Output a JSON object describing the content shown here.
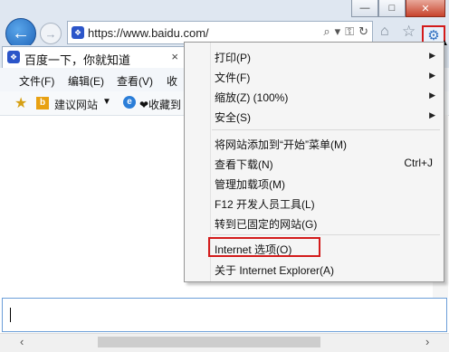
{
  "window": {
    "minimize": "—",
    "maximize": "□",
    "close": "✕"
  },
  "nav": {
    "back": "←",
    "forward": "→"
  },
  "address": {
    "url": "https://www.baidu.com/",
    "search": "⌕",
    "dropdown": "▾",
    "lock": "⚿",
    "refresh": "↻"
  },
  "toolbar": {
    "home": "⌂",
    "favorites": "☆",
    "tools": "⚙"
  },
  "tab": {
    "title": "百度一下，你就知道",
    "close": "×"
  },
  "menubar": [
    "文件(F)",
    "编辑(E)",
    "查看(V)",
    "收"
  ],
  "favbar": {
    "site": "建议网站",
    "arrow": "▼",
    "collect": "❤收藏到"
  },
  "scroll": {
    "left": "‹",
    "right": "›"
  },
  "tools_menu": {
    "print": "打印(P)",
    "file": "文件(F)",
    "zoom": "缩放(Z) (100%)",
    "safety": "安全(S)",
    "add_start": "将网站添加到“开始”菜单(M)",
    "downloads": "查看下载(N)",
    "downloads_shortcut": "Ctrl+J",
    "addons": "管理加载项(M)",
    "devtools": "F12 开发人员工具(L)",
    "pinned": "转到已固定的网站(G)",
    "internet_options": "Internet 选项(O)",
    "about": "关于 Internet Explorer(A)",
    "submenu_arrow": "▶"
  },
  "colors": {
    "highlight": "#d31b1b",
    "accent": "#1e63b8"
  }
}
